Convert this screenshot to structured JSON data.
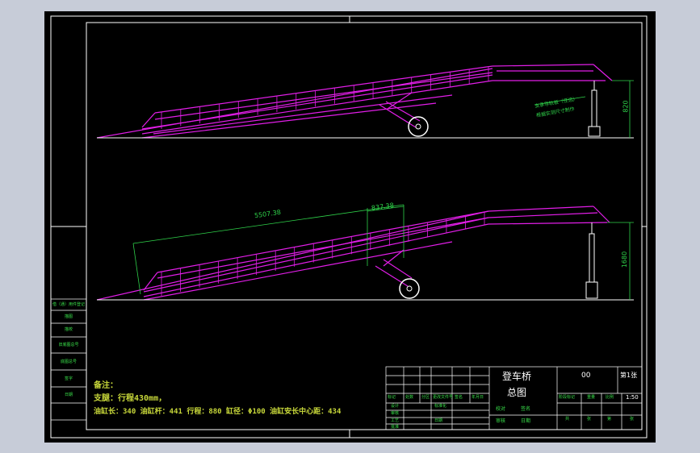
{
  "colors": {
    "frame": "#ffffff",
    "structure": "#e21ee8",
    "dimension": "#2fd34a",
    "ground": "#ffffff",
    "note": "#c8d83a",
    "paper": "#000000",
    "desktop": "#c7ccd8"
  },
  "dimensions": {
    "top_height": "820",
    "bottom_length": "5507.38",
    "bottom_sub": "837.38",
    "bottom_height": "1680"
  },
  "annotations": {
    "top_note_line1": "支承导轨板（任选）",
    "top_note_line2": "根据实测尺寸制作"
  },
  "notes": {
    "line1": "备注：",
    "line2": "支腿：行程430mm，",
    "line3": "油缸长：340 油缸杆：441 行程：880 缸径：Φ100 油缸安长中心距：434"
  },
  "title_block": {
    "name_line1": "登车桥",
    "name_line2": "总图",
    "drawing_no": "00",
    "sheet": "第1张",
    "scale": "1:50",
    "row_labels": [
      "标记",
      "处数",
      "分区",
      "更改文件号",
      "签名",
      "年月日"
    ],
    "role_labels": [
      "设计",
      "审核",
      "工艺",
      "批准"
    ],
    "left_cells": [
      "标准化",
      "日期"
    ],
    "bottom_labels": [
      "共",
      "张",
      "第",
      "张"
    ],
    "mid_labels": [
      "阶段标记",
      "重量",
      "比例"
    ],
    "sign_labels": [
      "校对",
      "签名",
      "审核",
      "日期"
    ]
  },
  "side_table": [
    "借（通）用件登记",
    "描图",
    "描校",
    "旧底图总号",
    "底图总号",
    "签字",
    "日期"
  ]
}
